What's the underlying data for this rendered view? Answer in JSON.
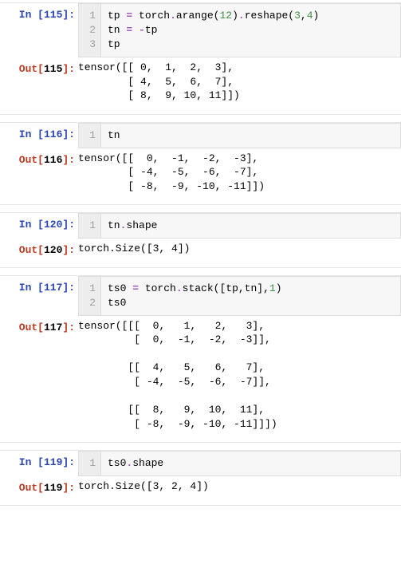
{
  "cells": [
    {
      "in_num": 115,
      "code_html": [
        "tp <span class='tok-op'>=</span> torch<span class='tok-op'>.</span>arange(<span class='tok-num'>12</span>)<span class='tok-op'>.</span>reshape(<span class='tok-num'>3</span>,<span class='tok-num'>4</span>)",
        "tn <span class='tok-op'>=</span> <span class='tok-op'>-</span>tp",
        "tp"
      ],
      "output": "tensor([[ 0,  1,  2,  3],\n        [ 4,  5,  6,  7],\n        [ 8,  9, 10, 11]])"
    },
    {
      "in_num": 116,
      "code_html": [
        "tn"
      ],
      "output": "tensor([[  0,  -1,  -2,  -3],\n        [ -4,  -5,  -6,  -7],\n        [ -8,  -9, -10, -11]])"
    },
    {
      "in_num": 120,
      "code_html": [
        "tn<span class='tok-op'>.</span>shape"
      ],
      "output": "torch.Size([3, 4])"
    },
    {
      "in_num": 117,
      "code_html": [
        "ts0 <span class='tok-op'>=</span> torch<span class='tok-op'>.</span>stack([tp,tn],<span class='tok-num'>1</span>)",
        "ts0"
      ],
      "output": "tensor([[[  0,   1,   2,   3],\n         [  0,  -1,  -2,  -3]],\n\n        [[  4,   5,   6,   7],\n         [ -4,  -5,  -6,  -7]],\n\n        [[  8,   9,  10,  11],\n         [ -8,  -9, -10, -11]]])"
    },
    {
      "in_num": 119,
      "code_html": [
        "ts0<span class='tok-op'>.</span>shape"
      ],
      "output": "torch.Size([3, 2, 4])"
    }
  ],
  "labels": {
    "in_prefix": "In [",
    "out_prefix": "Out[",
    "suffix": "]:"
  }
}
